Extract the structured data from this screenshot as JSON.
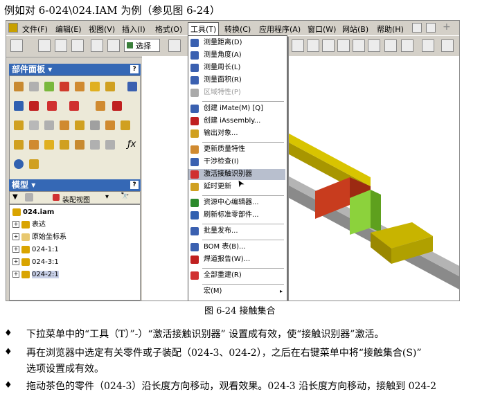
{
  "heading": "例如对 6-024\\024.IAM 为例（参见图 6-24）",
  "menubar": {
    "items": [
      "文件(F)",
      "编辑(E)",
      "视图(V)",
      "插入(I)",
      "格式(O)",
      "工具(T)",
      "转换(C)",
      "应用程序(A)",
      "窗口(W)",
      "网站(B)",
      "帮助(H)"
    ],
    "active_index": 5
  },
  "toolbar": {
    "select_label": "选择"
  },
  "parts_panel": {
    "title": "部件面板",
    "help": "?"
  },
  "model_panel": {
    "title": "模型",
    "help": "?",
    "assembly_view": "装配视图"
  },
  "tree": {
    "nodes": [
      {
        "label": "024.iam",
        "expander": "",
        "color": "#d9a400"
      },
      {
        "label": "表达",
        "expander": "+",
        "color": "#d9a400"
      },
      {
        "label": "原始坐标系",
        "expander": "+",
        "color": "#e8c870"
      },
      {
        "label": "024-1:1",
        "expander": "+",
        "color": "#d9a400"
      },
      {
        "label": "024-3:1",
        "expander": "+",
        "color": "#d9a400"
      },
      {
        "label": "024-2:1",
        "expander": "+",
        "color": "#d9a400"
      }
    ]
  },
  "tools_menu": {
    "items": [
      {
        "label": "测量距离(D)",
        "disabled": false,
        "highlight": false,
        "icon": "ruler-icon"
      },
      {
        "label": "测量角度(A)",
        "disabled": false,
        "highlight": false,
        "icon": "angle-icon"
      },
      {
        "label": "测量周长(L)",
        "disabled": false,
        "highlight": false,
        "icon": "loop-icon"
      },
      {
        "label": "测量面积(R)",
        "disabled": false,
        "highlight": false,
        "icon": "area-icon"
      },
      {
        "label": "区域特性(P)",
        "disabled": true,
        "highlight": false,
        "icon": "region-icon"
      },
      {
        "label": "创建 iMate(M)  [Q]",
        "disabled": false,
        "highlight": false,
        "icon": "imate-icon",
        "sep_before": true
      },
      {
        "label": "创建 iAssembly...",
        "disabled": false,
        "highlight": false,
        "icon": "iassembly-icon"
      },
      {
        "label": "输出对象...",
        "disabled": false,
        "highlight": false,
        "icon": "export-icon"
      },
      {
        "label": "更新质量特性",
        "disabled": false,
        "highlight": false,
        "icon": "mass-icon",
        "sep_before": true
      },
      {
        "label": "干涉检查(I)",
        "disabled": false,
        "highlight": false,
        "icon": "interference-icon"
      },
      {
        "label": "激活接触识别器",
        "disabled": false,
        "highlight": true,
        "icon": "contact-icon"
      },
      {
        "label": "延时更新",
        "disabled": false,
        "highlight": false,
        "icon": "delay-icon"
      },
      {
        "label": "资源中心编辑器...",
        "disabled": false,
        "highlight": false,
        "icon": "content-center-icon",
        "sep_before": true
      },
      {
        "label": "刷新标准零部件...",
        "disabled": false,
        "highlight": false,
        "icon": "refresh-icon"
      },
      {
        "label": "批量发布...",
        "disabled": false,
        "highlight": false,
        "icon": "publish-icon",
        "sep_before": true
      },
      {
        "label": "BOM 表(B)...",
        "disabled": false,
        "highlight": false,
        "icon": "bom-icon",
        "sep_before": true
      },
      {
        "label": "焊道报告(W)...",
        "disabled": false,
        "highlight": false,
        "icon": "weld-icon"
      },
      {
        "label": "全部重建(R)",
        "disabled": false,
        "highlight": false,
        "icon": "rebuild-icon",
        "sep_before": true
      },
      {
        "label": "宏(M)",
        "disabled": false,
        "highlight": false,
        "icon": "",
        "submenu": true,
        "sep_before": true
      }
    ]
  },
  "caption": "图 6-24 接触集合",
  "bullets": [
    "下拉菜单中的“工具（T）”-）“激活接触识别器” 设置成有效，使“接触识别器”激活。",
    "再在浏览器中选定有关零件或子装配（024-3、024-2），之后在右键菜单中将“接触集合(S)”",
    "选项设置成有效。",
    "拖动茶色的零件（024-3）沿长度方向移动，观看效果。024-3 沿长度方向移动，接触到 024-2"
  ],
  "bullet_symbol": "♦",
  "colors": {
    "panel_title": "#3568b5",
    "highlight": "#b8bfce",
    "part_olive": "#c8b400",
    "part_red": "#c83c1e",
    "part_green": "#8cd23c",
    "rail": "#9a9a9a"
  }
}
